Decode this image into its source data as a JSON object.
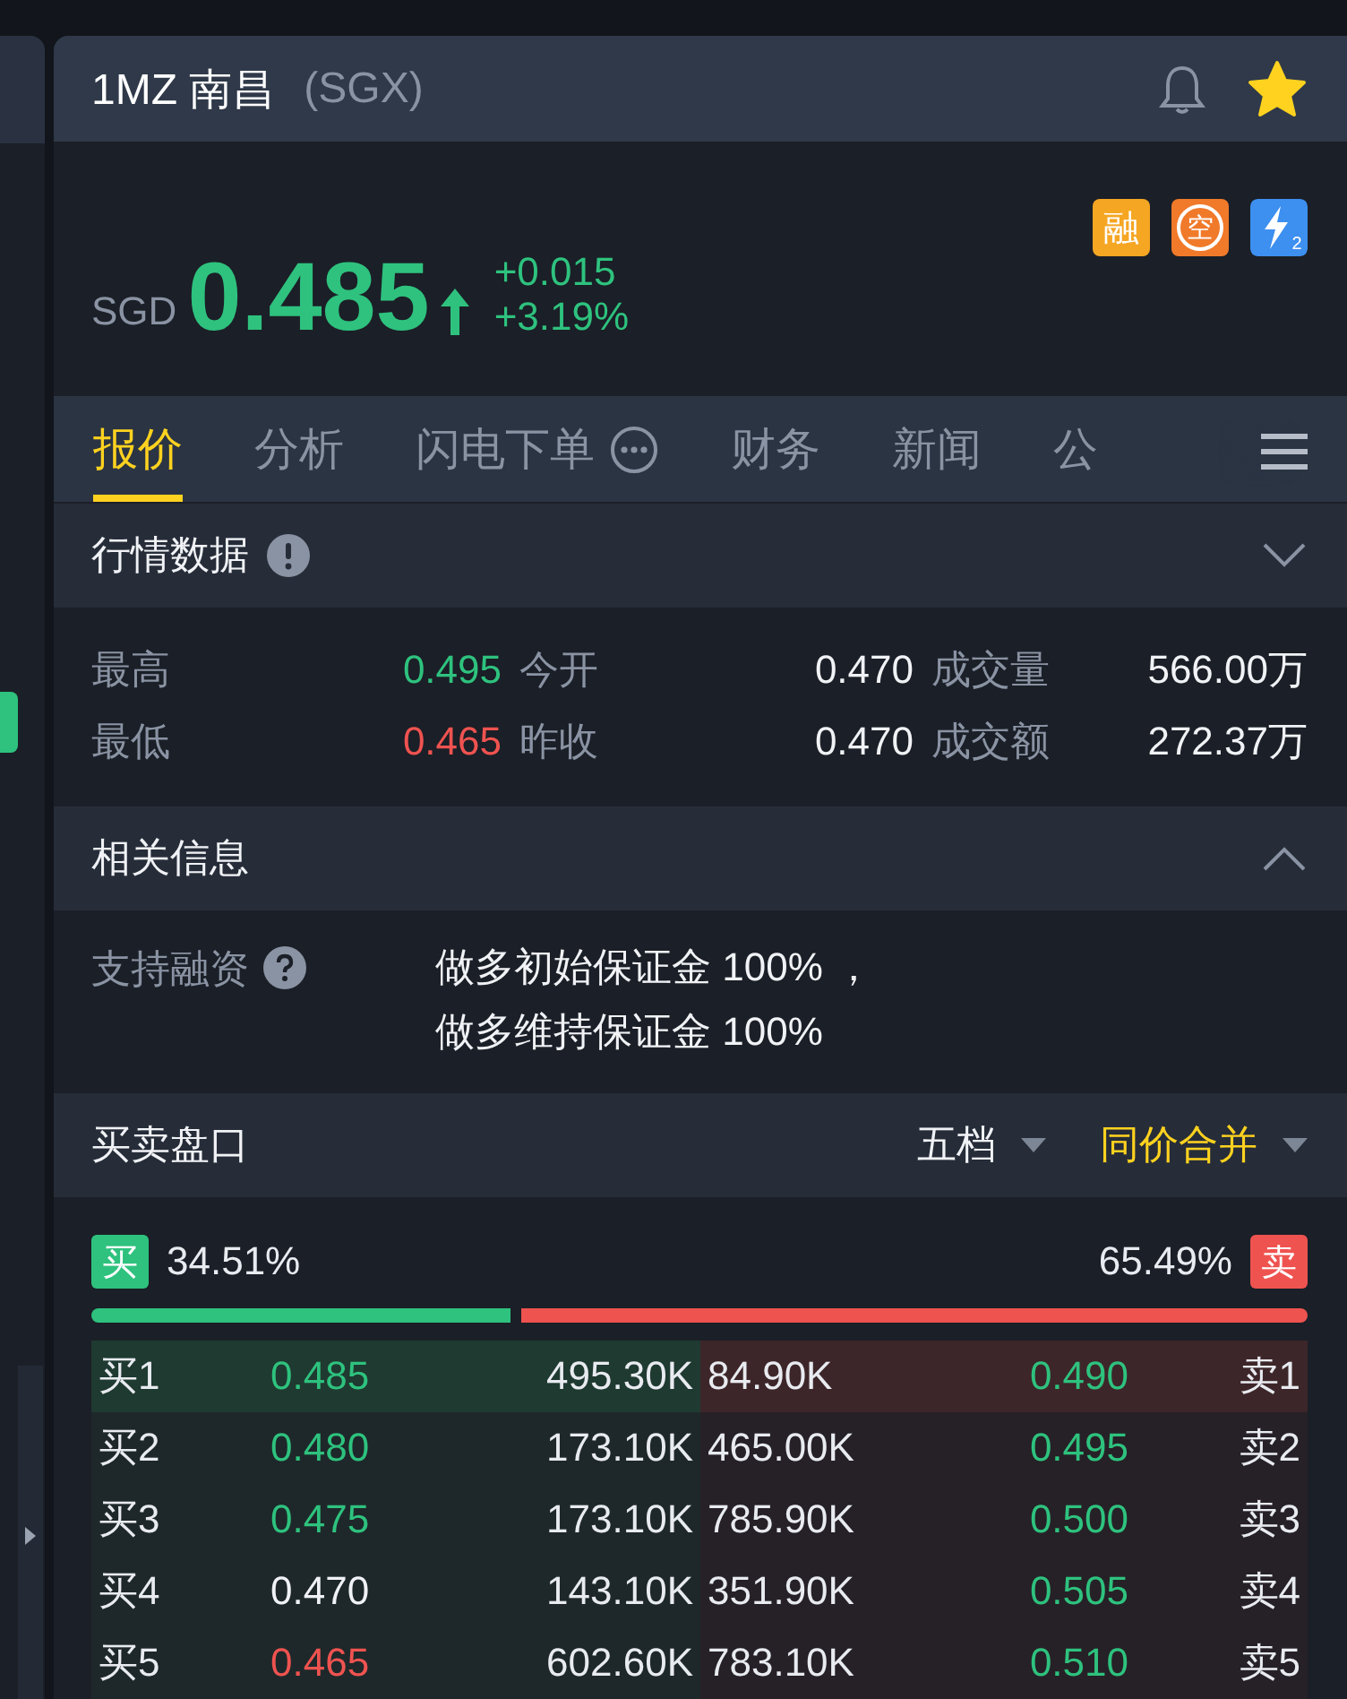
{
  "header": {
    "symbol": "1MZ",
    "name": "南昌",
    "exchange": "(SGX)",
    "alert_on": false,
    "favorite": true
  },
  "quote": {
    "currency": "SGD",
    "price": "0.485",
    "rising": true,
    "color": "#2ec27e",
    "change": "+0.015",
    "change_pct": "+3.19%"
  },
  "badges": [
    {
      "kind": "text",
      "label": "融",
      "color": "#f5a623"
    },
    {
      "kind": "text",
      "label": "空",
      "color": "#f07a2a"
    },
    {
      "kind": "icon",
      "label": "2",
      "color": "#3d8ff0"
    }
  ],
  "tabs": [
    {
      "label": "报价",
      "selected": true,
      "kind": "text"
    },
    {
      "label": "分析",
      "selected": false,
      "kind": "text"
    },
    {
      "label": "闪电下单",
      "selected": false,
      "kind": "more"
    },
    {
      "label": "财务",
      "selected": false,
      "kind": "text"
    },
    {
      "label": "新闻",
      "selected": false,
      "kind": "text"
    },
    {
      "label": "公",
      "selected": false,
      "kind": "text"
    }
  ],
  "market_data": {
    "title": "行情数据",
    "expanded": false,
    "stats": [
      {
        "label": "最高",
        "value": "0.495",
        "color": "#2ec27e"
      },
      {
        "label": "今开",
        "value": "0.470",
        "color": "#f0f2f5"
      },
      {
        "label": "成交量",
        "value": "566.00万",
        "color": "#f0f2f5"
      },
      {
        "label": "最低",
        "value": "0.465",
        "color": "#ef5350"
      },
      {
        "label": "昨收",
        "value": "0.470",
        "color": "#f0f2f5"
      },
      {
        "label": "成交额",
        "value": "272.37万",
        "color": "#f0f2f5"
      }
    ]
  },
  "related_info": {
    "title": "相关信息",
    "expanded": true,
    "label": "支持融资",
    "lines": [
      "做多初始保证金 100% ，",
      "做多维持保证金 100%"
    ]
  },
  "order_book": {
    "title": "买卖盘口",
    "options": [
      {
        "label": "五档",
        "selected": false
      },
      {
        "label": "同价合并",
        "selected": true
      }
    ],
    "buy_label": "买",
    "buy_pct": "34.51%",
    "sell_label": "卖",
    "sell_pct": "65.49%",
    "level": 0.3451,
    "rows": [
      {
        "highlighted": true,
        "bid": {
          "label": "买1",
          "price": "0.485",
          "color": "#2ec27e",
          "qty": "495.30K"
        },
        "ask": {
          "qty": "84.90K",
          "price": "0.490",
          "color": "#2ec27e",
          "label": "卖1"
        }
      },
      {
        "highlighted": false,
        "bid": {
          "label": "买2",
          "price": "0.480",
          "color": "#2ec27e",
          "qty": "173.10K"
        },
        "ask": {
          "qty": "465.00K",
          "price": "0.495",
          "color": "#2ec27e",
          "label": "卖2"
        }
      },
      {
        "highlighted": false,
        "bid": {
          "label": "买3",
          "price": "0.475",
          "color": "#2ec27e",
          "qty": "173.10K"
        },
        "ask": {
          "qty": "785.90K",
          "price": "0.500",
          "color": "#2ec27e",
          "label": "卖3"
        }
      },
      {
        "highlighted": false,
        "bid": {
          "label": "买4",
          "price": "0.470",
          "color": "#f0f2f5",
          "qty": "143.10K"
        },
        "ask": {
          "qty": "351.90K",
          "price": "0.505",
          "color": "#2ec27e",
          "label": "卖4"
        }
      },
      {
        "highlighted": false,
        "bid": {
          "label": "买5",
          "price": "0.465",
          "color": "#ef5350",
          "qty": "602.60K"
        },
        "ask": {
          "qty": "783.10K",
          "price": "0.510",
          "color": "#2ec27e",
          "label": "卖5"
        }
      }
    ]
  }
}
